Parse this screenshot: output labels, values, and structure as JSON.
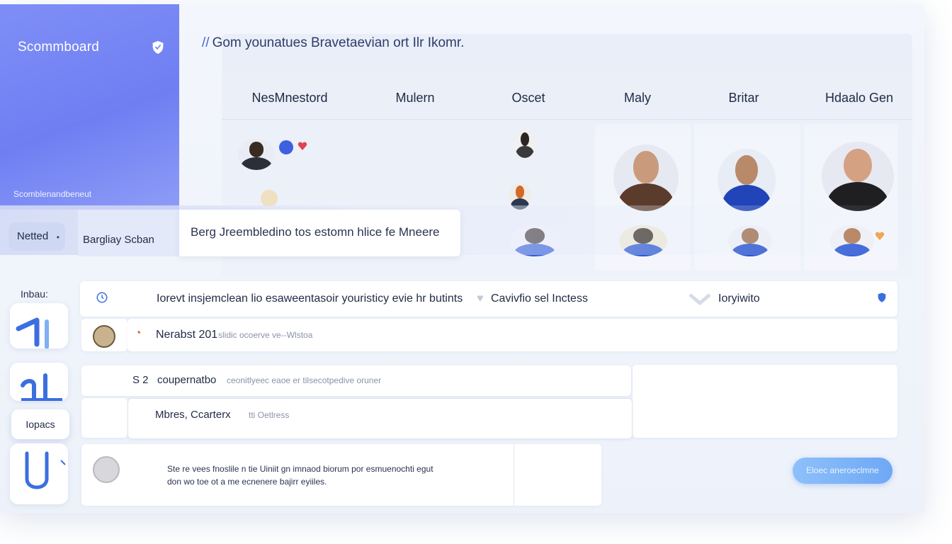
{
  "sidebar": {
    "brand": "Scommboard",
    "subtitle": "Scomblenandbeneut",
    "filter_netted": "Netted",
    "filter_bargain": "Bargliay Scban",
    "inbox_label": "Inbau:",
    "nav_pill": "Iopacs",
    "accent": "#7584f3"
  },
  "header": {
    "title": "Gom younatues Bravetaevian ort Ilr Ikomr."
  },
  "search": {
    "value": "Berg Jreembledino tos estomn hlice fe Mneere"
  },
  "columns": [
    "NesMnestord",
    "Mulern",
    "Oscet",
    "Maly",
    "Britar",
    "Hdaalo Gen"
  ],
  "rows": [
    {
      "text": "Iorevt insjemclean lio esaweentasoir youristicy evie hr butints",
      "tag": "Cavivfio sel Inctess",
      "extra": "Ioryiwito"
    },
    {
      "title": "Nerabst 201",
      "meta": "slidic ocoerve ve--Wlstoa"
    },
    {
      "number": "S 2",
      "title": "coupernatbo",
      "meta": "ceonitlyeec eaoe er tilsecotpedive oruner"
    },
    {
      "title": "Mbres, Ccarterx",
      "meta": "tti Oetlress"
    },
    {
      "line1": "Ste re vees fnoslile n tie Uiniit gn imnaod biorum por esmuenochti egut",
      "line2": "don wo toe ot a me ecnenere bajirr eyiiles."
    }
  ],
  "cta": {
    "label": "Eloec aneroeclmne"
  },
  "colors": {
    "sidebar_gradient_start": "#7f8ef6",
    "cta": "#6ea8f5",
    "icon_blue": "#3b6fe0"
  }
}
